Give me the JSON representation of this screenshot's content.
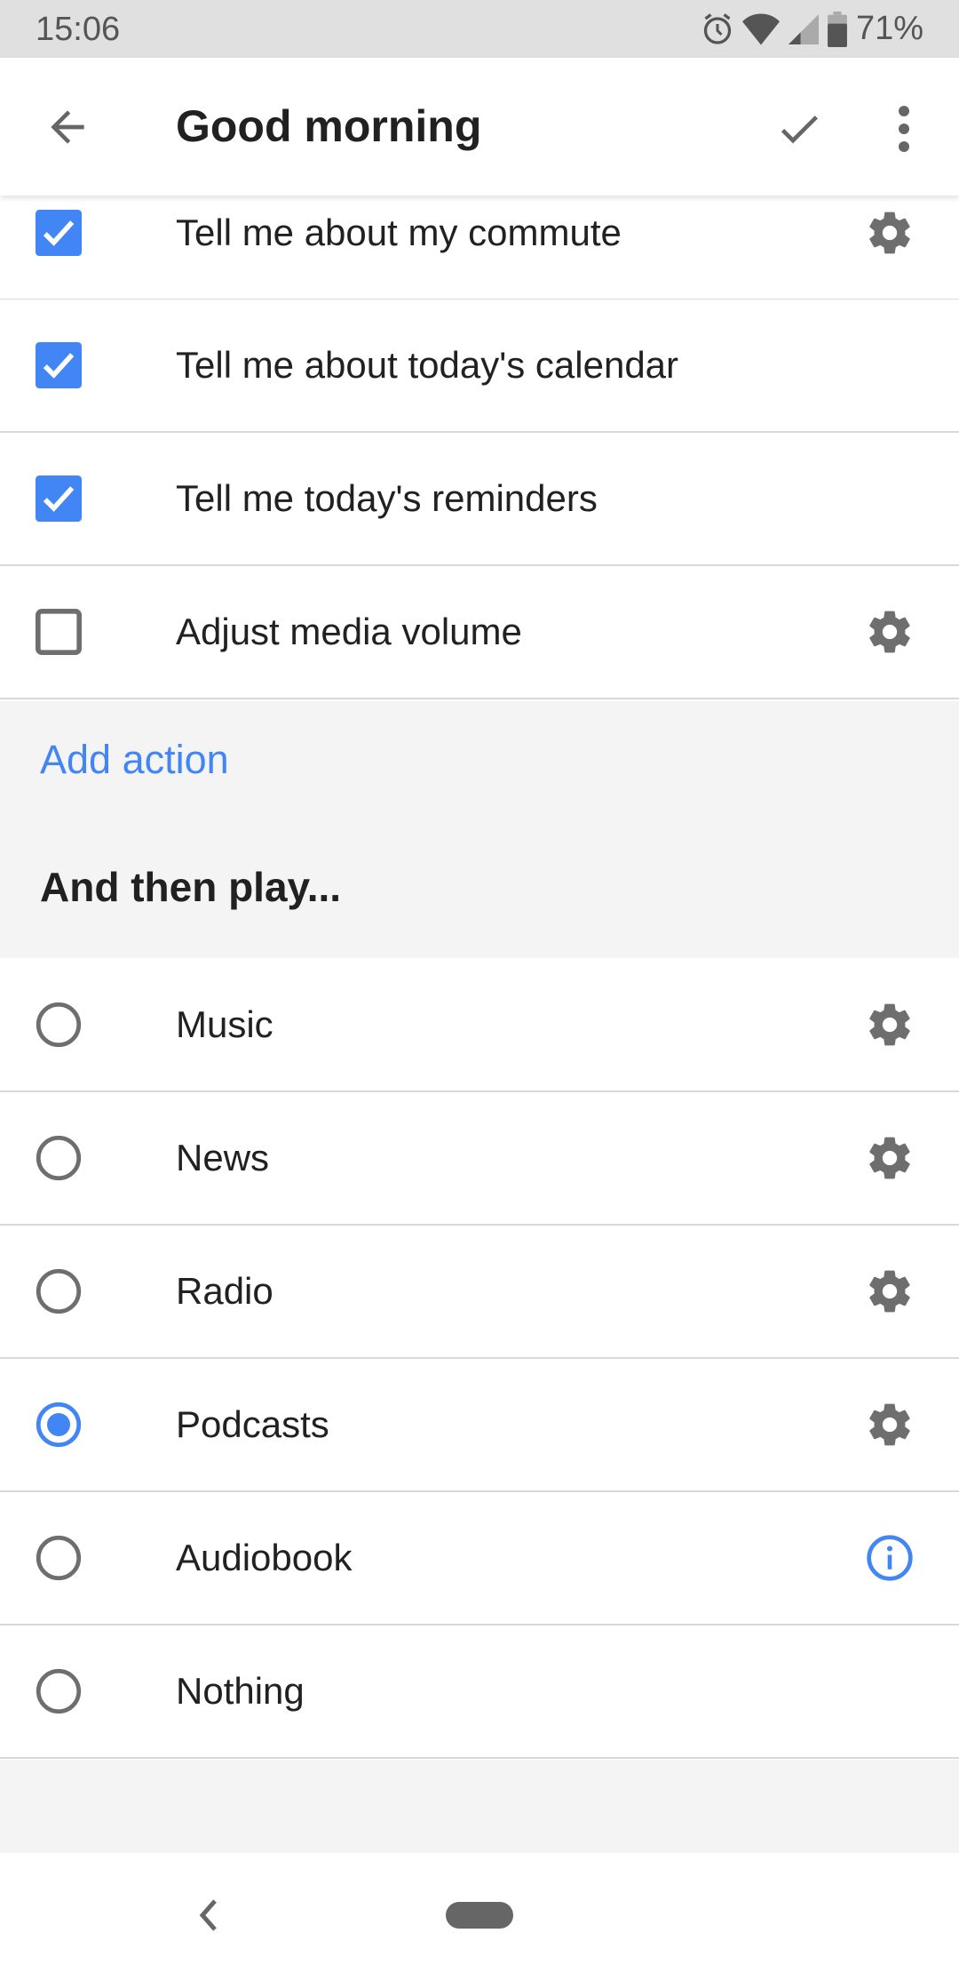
{
  "status_bar": {
    "time": "15:06",
    "icons": [
      "alarm-icon",
      "wifi-icon",
      "cell-signal-icon",
      "battery-icon"
    ],
    "battery": "71%"
  },
  "app_bar": {
    "back_icon": "arrow-back-icon",
    "title": "Good morning",
    "save_icon": "check-icon",
    "menu_icon": "more-vert-icon"
  },
  "actions": [
    {
      "label": "Tell me about my commute",
      "checked": true,
      "trailing": "gear-icon"
    },
    {
      "label": "Tell me about today's calendar",
      "checked": true,
      "trailing": ""
    },
    {
      "label": "Tell me today's reminders",
      "checked": true,
      "trailing": ""
    },
    {
      "label": "Adjust media volume",
      "checked": false,
      "trailing": "gear-icon"
    }
  ],
  "add_action_label": "Add action",
  "then_play": {
    "heading": "And then play...",
    "options": [
      {
        "label": "Music",
        "selected": false,
        "trailing": "gear-icon"
      },
      {
        "label": "News",
        "selected": false,
        "trailing": "gear-icon"
      },
      {
        "label": "Radio",
        "selected": false,
        "trailing": "gear-icon"
      },
      {
        "label": "Podcasts",
        "selected": true,
        "trailing": "gear-icon"
      },
      {
        "label": "Audiobook",
        "selected": false,
        "trailing": "info-icon"
      },
      {
        "label": "Nothing",
        "selected": false,
        "trailing": ""
      }
    ]
  },
  "colors": {
    "accent": "#4285f4",
    "icon_gray": "#6e6e6e",
    "divider": "#d9d9d9",
    "section_bg": "#f4f4f4"
  }
}
